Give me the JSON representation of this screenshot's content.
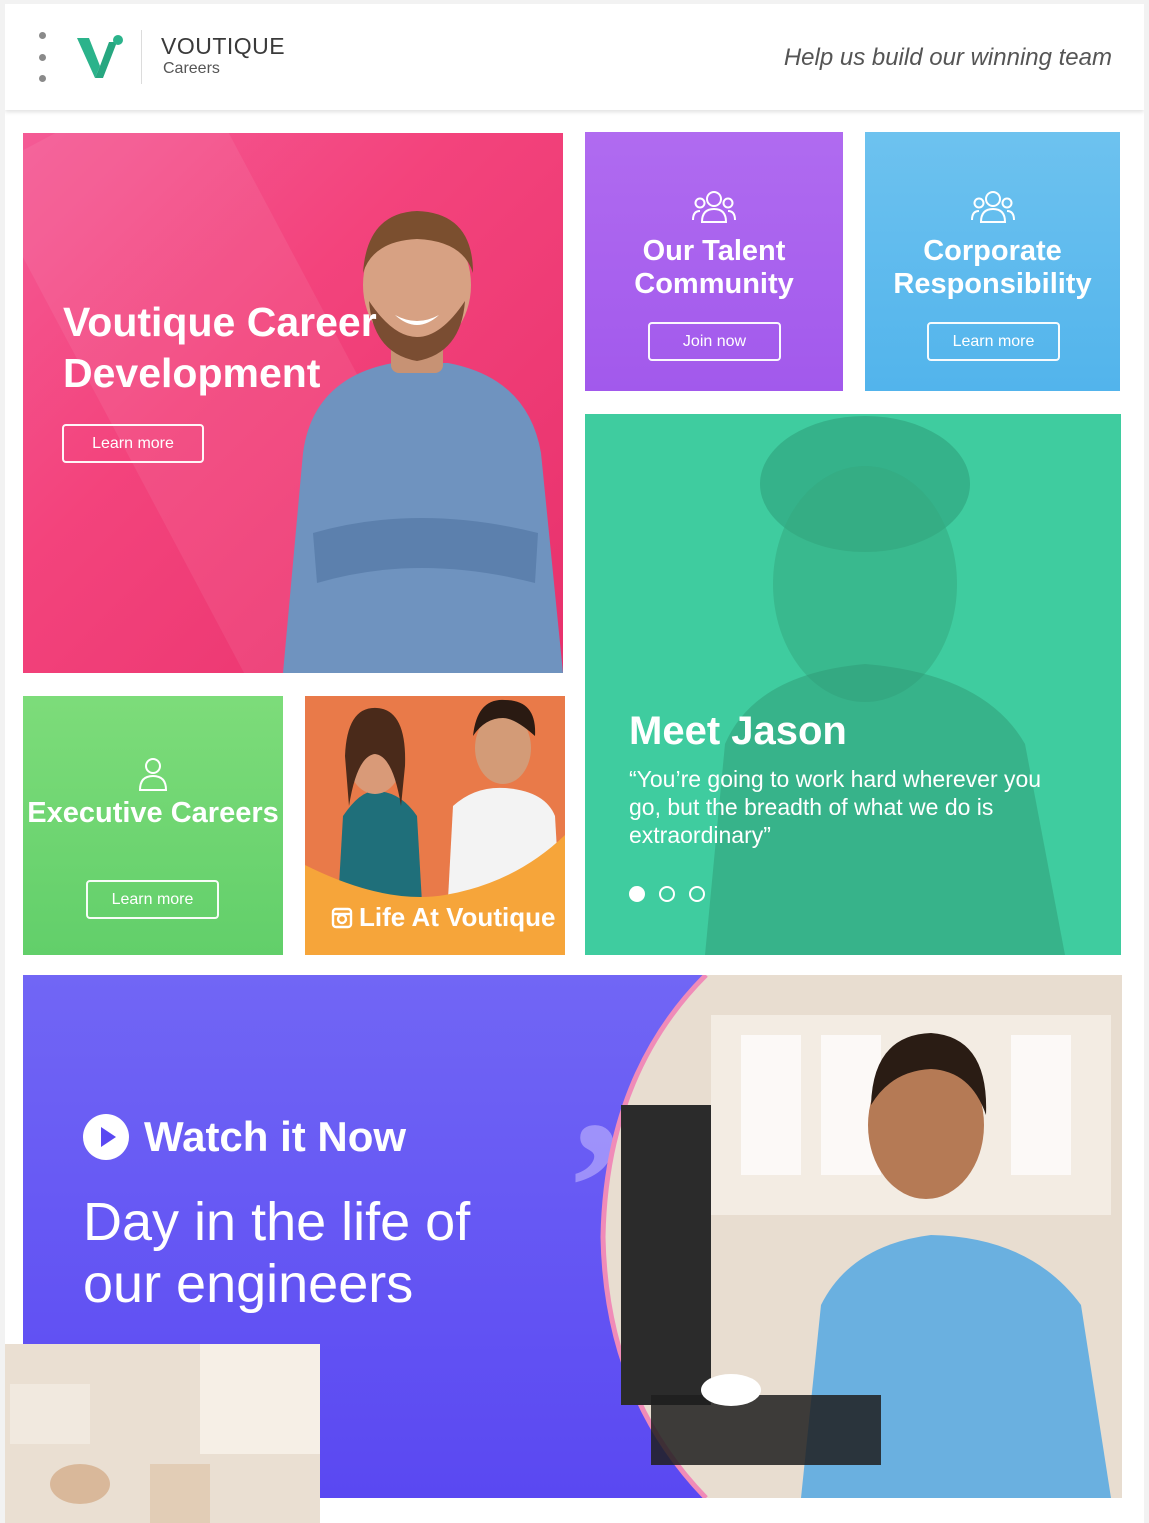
{
  "header": {
    "brand_name": "VOUTIQUE",
    "brand_sub": "Careers",
    "tagline": "Help us build our winning team"
  },
  "tiles": {
    "career": {
      "title": "Voutique Career Development",
      "button": "Learn more"
    },
    "talent": {
      "title": "Our Talent Community",
      "button": "Join now"
    },
    "csr": {
      "title": "Corporate Responsibility",
      "button": "Learn more"
    },
    "jason": {
      "name": "Meet Jason",
      "quote": "“You’re going to work hard wherever you go, but the breadth of what we do is extraordinary”"
    },
    "executive": {
      "title": "Executive Careers",
      "button": "Learn more"
    },
    "life": {
      "label": "Life At Voutique"
    },
    "watch": {
      "title": "Watch it Now",
      "subtitle": "Day in the life of our engineers"
    }
  },
  "colors": {
    "pink": "#f3437c",
    "purple": "#a259ec",
    "blue": "#52b4ec",
    "teal": "#3fcc9f",
    "green": "#62cf6a",
    "orange": "#f06b3a",
    "indigo": "#5a48f2",
    "logo_teal": "#2bb38b"
  },
  "icons": {
    "menu": "more-vertical-icon",
    "talent": "group-icon",
    "csr": "group-icon",
    "executive": "user-icon",
    "life": "instagram-icon",
    "watch": "play-icon"
  }
}
